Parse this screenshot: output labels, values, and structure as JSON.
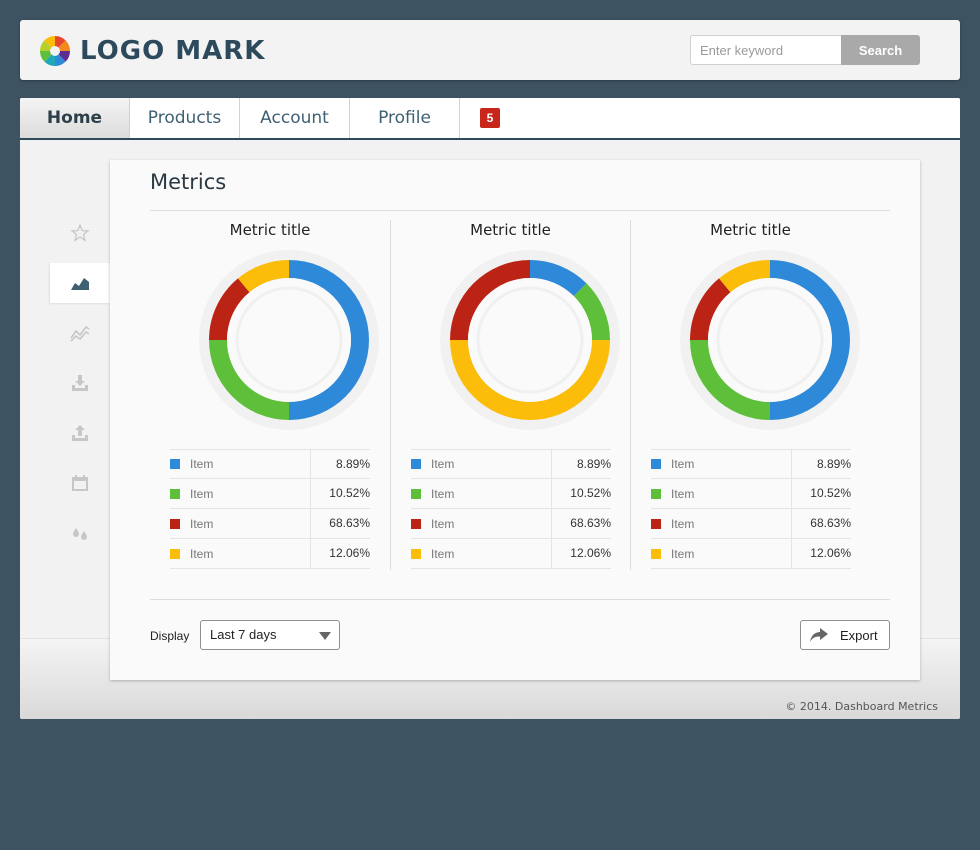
{
  "header": {
    "logo_text": "LOGO MARK",
    "search_placeholder": "Enter keyword",
    "search_button": "Search"
  },
  "tabs": [
    {
      "label": "Home",
      "active": true
    },
    {
      "label": "Products",
      "active": false
    },
    {
      "label": "Account",
      "active": false
    },
    {
      "label": "Profile",
      "active": false
    }
  ],
  "notification_count": "5",
  "sidenav": [
    {
      "icon": "star-icon",
      "active": false
    },
    {
      "icon": "area-chart-icon",
      "active": true
    },
    {
      "icon": "line-chart-icon",
      "active": false
    },
    {
      "icon": "download-icon",
      "active": false
    },
    {
      "icon": "upload-icon",
      "active": false
    },
    {
      "icon": "calendar-icon",
      "active": false
    },
    {
      "icon": "drops-icon",
      "active": false
    }
  ],
  "card": {
    "title": "Metrics",
    "display_label": "Display",
    "display_value": "Last 7 days",
    "export_label": "Export"
  },
  "colors": {
    "blue": "#2e89d8",
    "green": "#5ec03a",
    "red": "#bb2314",
    "yellow": "#fbbc0a"
  },
  "legend_colors": [
    "#2e89d8",
    "#5ec03a",
    "#bb2314",
    "#fbbc0a"
  ],
  "chart_data": [
    {
      "type": "pie",
      "title": "Metric title",
      "slices": [
        {
          "label": "Item",
          "value": 50,
          "color": "#2e89d8"
        },
        {
          "label": "Item",
          "value": 25,
          "color": "#5ec03a"
        },
        {
          "label": "Item",
          "value": 14,
          "color": "#bb2314"
        },
        {
          "label": "Item",
          "value": 11,
          "color": "#fbbc0a"
        }
      ],
      "legend": [
        {
          "label": "Item",
          "value": "8.89%"
        },
        {
          "label": "Item",
          "value": "10.52%"
        },
        {
          "label": "Item",
          "value": "68.63%"
        },
        {
          "label": "Item",
          "value": "12.06%"
        }
      ]
    },
    {
      "type": "pie",
      "title": "Metric title",
      "slices": [
        {
          "label": "Item",
          "value": 12.5,
          "color": "#2e89d8"
        },
        {
          "label": "Item",
          "value": 12.5,
          "color": "#5ec03a"
        },
        {
          "label": "Item",
          "value": 50,
          "color": "#fbbc0a"
        },
        {
          "label": "Item",
          "value": 25,
          "color": "#bb2314"
        }
      ],
      "legend": [
        {
          "label": "Item",
          "value": "8.89%"
        },
        {
          "label": "Item",
          "value": "10.52%"
        },
        {
          "label": "Item",
          "value": "68.63%"
        },
        {
          "label": "Item",
          "value": "12.06%"
        }
      ]
    },
    {
      "type": "pie",
      "title": "Metric title",
      "slices": [
        {
          "label": "Item",
          "value": 50,
          "color": "#2e89d8"
        },
        {
          "label": "Item",
          "value": 25,
          "color": "#5ec03a"
        },
        {
          "label": "Item",
          "value": 14,
          "color": "#bb2314"
        },
        {
          "label": "Item",
          "value": 11,
          "color": "#fbbc0a"
        }
      ],
      "legend": [
        {
          "label": "Item",
          "value": "8.89%"
        },
        {
          "label": "Item",
          "value": "10.52%"
        },
        {
          "label": "Item",
          "value": "68.63%"
        },
        {
          "label": "Item",
          "value": "12.06%"
        }
      ]
    }
  ],
  "footer": {
    "copyright": "© 2014. Dashboard Metrics"
  }
}
